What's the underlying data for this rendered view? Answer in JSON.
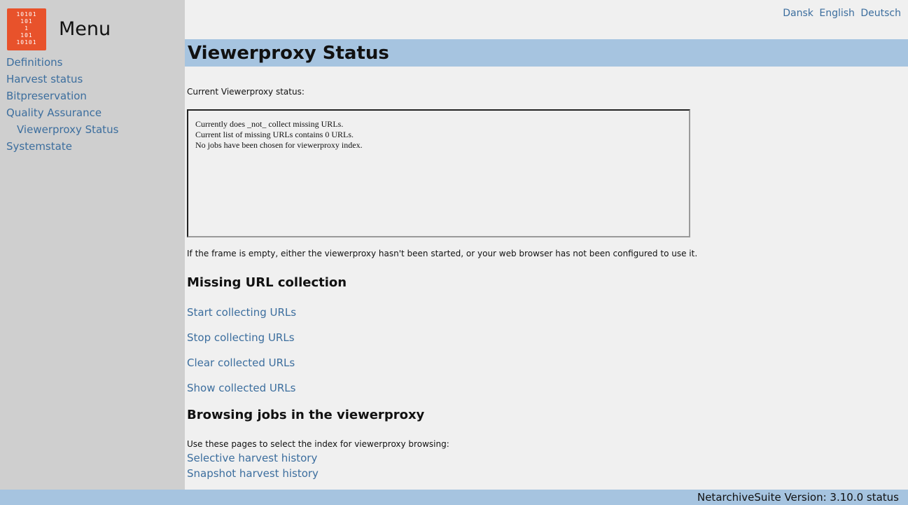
{
  "sidebar": {
    "logo_rows": [
      "10101",
      "101",
      "1",
      "101",
      "10101"
    ],
    "menu_title": "Menu",
    "items": [
      {
        "label": "Definitions"
      },
      {
        "label": "Harvest status"
      },
      {
        "label": "Bitpreservation"
      },
      {
        "label": "Quality Assurance"
      },
      {
        "label": "Viewerproxy Status"
      },
      {
        "label": "Systemstate"
      }
    ]
  },
  "header": {
    "languages": [
      "Dansk",
      "English",
      "Deutsch"
    ]
  },
  "main": {
    "title": "Viewerproxy Status",
    "status_label": "Current Viewerproxy status:",
    "status_frame": "Currently does _not_ collect missing URLs.\nCurrent list of missing URLs contains 0 URLs.\nNo jobs have been chosen for viewerproxy index.",
    "frame_note": "If the frame is empty, either the viewerproxy hasn't been started, or your web browser has not been configured to use it.",
    "missing_section": {
      "heading": "Missing URL collection",
      "links": [
        "Start collecting URLs",
        "Stop collecting URLs",
        "Clear collected URLs",
        "Show collected URLs"
      ]
    },
    "browse_section": {
      "heading": "Browsing jobs in the viewerproxy",
      "intro": "Use these pages to select the index for viewerproxy browsing:",
      "links": [
        "Selective harvest history",
        "Snapshot harvest history"
      ]
    }
  },
  "footer": {
    "text": "NetarchiveSuite Version: 3.10.0 status"
  },
  "colors": {
    "sidebar_bg": "#cfcfcf",
    "title_bar_bg": "#a6c4e0",
    "link": "#3c6e9e",
    "logo_bg": "#e8522b"
  }
}
